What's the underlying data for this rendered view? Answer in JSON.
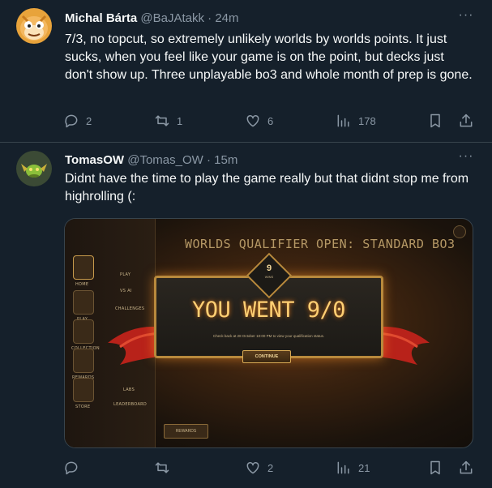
{
  "tweets": [
    {
      "author_name": "Michal Bárta",
      "handle": "@BaJAtakk",
      "separator": "·",
      "time": "24m",
      "text": "7/3, no topcut, so extremely unlikely worlds by worlds points. It just sucks, when you feel like your game is on the point, but decks just don't show up. Three unplayable bo3 and whole month of prep is gone.",
      "replies": "2",
      "reposts": "1",
      "likes": "6",
      "views": "178",
      "more_label": "···"
    },
    {
      "author_name": "TomasOW",
      "handle": "@Tomas_OW",
      "separator": "·",
      "time": "15m",
      "text": "Didnt have the time to play the game really but that didnt stop me from highrolling (:",
      "replies": "",
      "reposts": "",
      "likes": "2",
      "views": "21",
      "more_label": "···",
      "media": {
        "game_title": "WORLDS QUALIFIER OPEN: STANDARD BO3",
        "wins_number": "9",
        "wins_label": "WINS",
        "result_text": "YOU WENT 9/0",
        "subtext": "Check back at 28 October 10:00 PM to view your qualification status.",
        "continue_label": "CONTINUE",
        "rewards_label": "REWARDS",
        "sidebar": {
          "home": "HOME",
          "play": "PLAY",
          "collection": "COLLECTION",
          "rewards": "REWARDS",
          "store": "STORE",
          "menu_play": "PLAY",
          "menu_vs_ai": "VS AI",
          "menu_challenges": "CHALLENGES",
          "menu_labs": "LABS",
          "menu_leaderboard": "LEADERBOARD"
        }
      }
    }
  ],
  "colors": {
    "background": "#15202b",
    "text_primary": "#f7f9f9",
    "text_secondary": "#8b98a5",
    "divider": "#38444d",
    "game_gold": "#ffcf73"
  }
}
